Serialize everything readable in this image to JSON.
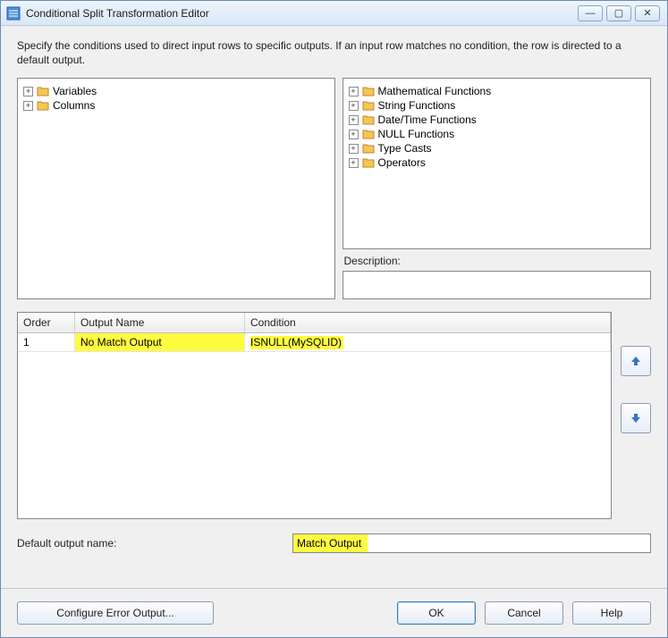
{
  "window": {
    "title": "Conditional Split Transformation Editor"
  },
  "intro": "Specify the conditions used to direct input rows to specific outputs. If an input row matches no condition, the row is directed to a default output.",
  "leftTree": {
    "items": [
      {
        "label": "Variables"
      },
      {
        "label": "Columns"
      }
    ]
  },
  "rightTree": {
    "items": [
      {
        "label": "Mathematical Functions"
      },
      {
        "label": "String Functions"
      },
      {
        "label": "Date/Time Functions"
      },
      {
        "label": "NULL Functions"
      },
      {
        "label": "Type Casts"
      },
      {
        "label": "Operators"
      }
    ]
  },
  "descriptionLabel": "Description:",
  "grid": {
    "headers": {
      "order": "Order",
      "name": "Output Name",
      "condition": "Condition"
    },
    "rows": [
      {
        "order": "1",
        "name": "No Match Output",
        "condition": "ISNULL(MySQLID)"
      }
    ]
  },
  "defaultOutput": {
    "label": "Default output name:",
    "value": "Match Output"
  },
  "buttons": {
    "configure": "Configure Error Output...",
    "ok": "OK",
    "cancel": "Cancel",
    "help": "Help"
  }
}
